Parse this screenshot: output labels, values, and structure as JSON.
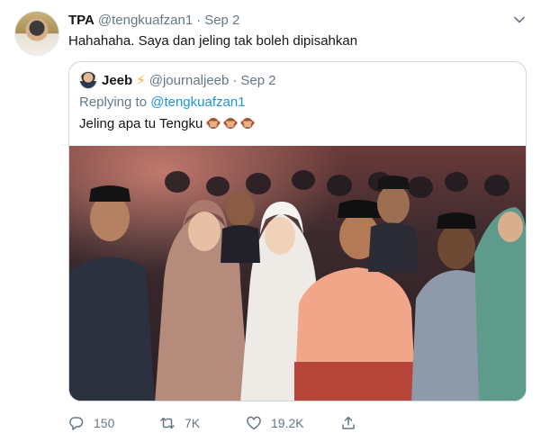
{
  "tweet": {
    "display_name": "TPA",
    "handle": "@tengkuafzan1",
    "separator": "·",
    "date": "Sep 2",
    "text": "Hahahaha. Saya dan jeling tak boleh dipisahkan"
  },
  "quoted": {
    "display_name": "Jeeb",
    "name_emoji": "⚡",
    "handle": "@journaljeeb",
    "separator": "·",
    "date": "Sep 2",
    "replying_prefix": "Replying to",
    "replying_to": "@tengkuafzan1",
    "text": "Jeling apa tu Tengku",
    "emojis": [
      "see-no-evil-monkey",
      "see-no-evil-monkey",
      "see-no-evil-monkey"
    ]
  },
  "actions": {
    "replies": "150",
    "retweets": "7K",
    "likes": "19.2K"
  },
  "icons": [
    "caret-down-icon",
    "reply-icon",
    "retweet-icon",
    "like-icon",
    "share-icon"
  ],
  "colors": {
    "text": "#14171a",
    "secondary": "#657786",
    "link": "#1b95e0",
    "border": "#ccd6dd"
  }
}
